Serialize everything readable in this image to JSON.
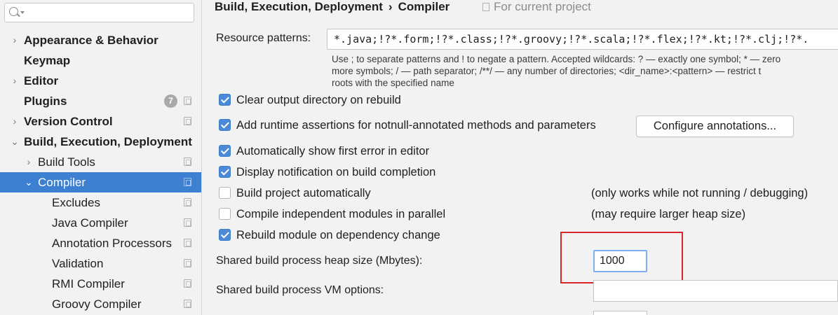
{
  "sidebar": {
    "search_placeholder": "",
    "items": [
      {
        "label": "Appearance & Behavior"
      },
      {
        "label": "Keymap"
      },
      {
        "label": "Editor"
      },
      {
        "label": "Plugins",
        "badge": "7"
      },
      {
        "label": "Version Control"
      },
      {
        "label": "Build, Execution, Deployment"
      },
      {
        "label": "Build Tools"
      },
      {
        "label": "Compiler"
      },
      {
        "label": "Excludes"
      },
      {
        "label": "Java Compiler"
      },
      {
        "label": "Annotation Processors"
      },
      {
        "label": "Validation"
      },
      {
        "label": "RMI Compiler"
      },
      {
        "label": "Groovy Compiler"
      }
    ]
  },
  "header": {
    "breadcrumb_parent": "Build, Execution, Deployment",
    "breadcrumb_sep": "›",
    "breadcrumb_current": "Compiler",
    "scope": "For current project"
  },
  "resource_patterns": {
    "label": "Resource patterns:",
    "value": "*.java;!?*.form;!?*.class;!?*.groovy;!?*.scala;!?*.flex;!?*.kt;!?*.clj;!?*.",
    "hint_line1": "Use ; to separate patterns and ! to negate a pattern. Accepted wildcards: ? — exactly one symbol; * — zero",
    "hint_line2": "more symbols; / — path separator; /**/ — any number of directories; <dir_name>:<pattern> — restrict t",
    "hint_line3": "roots with the specified name"
  },
  "options": [
    {
      "label": "Clear output directory on rebuild",
      "checked": true
    },
    {
      "label": "Add runtime assertions for notnull-annotated methods and parameters",
      "checked": true
    },
    {
      "label": "Automatically show first error in editor",
      "checked": true
    },
    {
      "label": "Display notification on build completion",
      "checked": true
    },
    {
      "label": "Build project automatically",
      "checked": false,
      "note": "(only works while not running / debugging)"
    },
    {
      "label": "Compile independent modules in parallel",
      "checked": false,
      "note": "(may require larger heap size)"
    },
    {
      "label": "Rebuild module on dependency change",
      "checked": true
    }
  ],
  "configure_button": "Configure annotations...",
  "heap": {
    "label": "Shared build process heap size (Mbytes):",
    "value": "1000"
  },
  "vm_options": {
    "label": "Shared build process VM options:",
    "value": ""
  },
  "colors": {
    "selection": "#3d7fd1",
    "checkbox": "#4a8ad6",
    "highlight": "#d7262b"
  }
}
